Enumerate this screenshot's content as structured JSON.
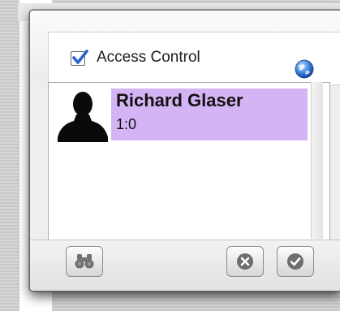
{
  "panel": {
    "title": "Access Control",
    "checkbox_checked": true,
    "icons": {
      "header": "globe-icon",
      "user": "person-silhouette-icon",
      "search": "binoculars-icon",
      "cancel": "x-circle-icon",
      "confirm": "checkmark-circle-icon"
    }
  },
  "users": [
    {
      "name": "Richard Glaser",
      "code": "1:0",
      "selected": true
    }
  ],
  "colors": {
    "selection": "#d5b4f5",
    "checkbox_accent": "#2a63c9"
  }
}
